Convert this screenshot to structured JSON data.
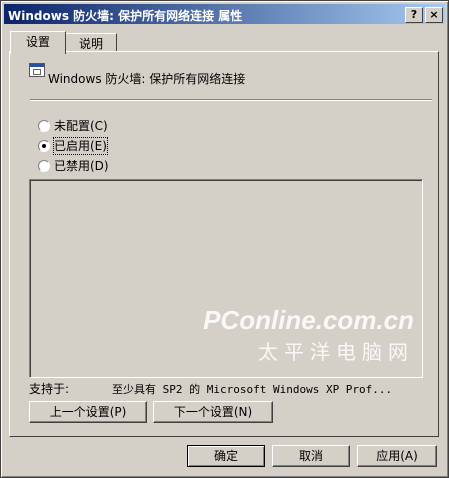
{
  "window": {
    "title": "Windows 防火墙: 保护所有网络连接 属性",
    "help_button": "?",
    "close_button": "×"
  },
  "tabs": [
    {
      "label": "设置"
    },
    {
      "label": "说明"
    }
  ],
  "policy": {
    "title": "Windows 防火墙: 保护所有网络连接"
  },
  "options": [
    {
      "label": "未配置(C)",
      "checked": false
    },
    {
      "label": "已启用(E)",
      "checked": true
    },
    {
      "label": "已禁用(D)",
      "checked": false
    }
  ],
  "support": {
    "label": "支持于:",
    "value": "至少具有 SP2 的 Microsoft Windows XP Prof..."
  },
  "nav": {
    "prev_label": "上一个设置(P)",
    "next_label": "下一个设置(N)"
  },
  "footer": {
    "ok_label": "确定",
    "cancel_label": "取消",
    "apply_label": "应用(A)"
  },
  "watermark": {
    "main": "PConline.com.cn",
    "sub": "太平洋电脑网"
  }
}
